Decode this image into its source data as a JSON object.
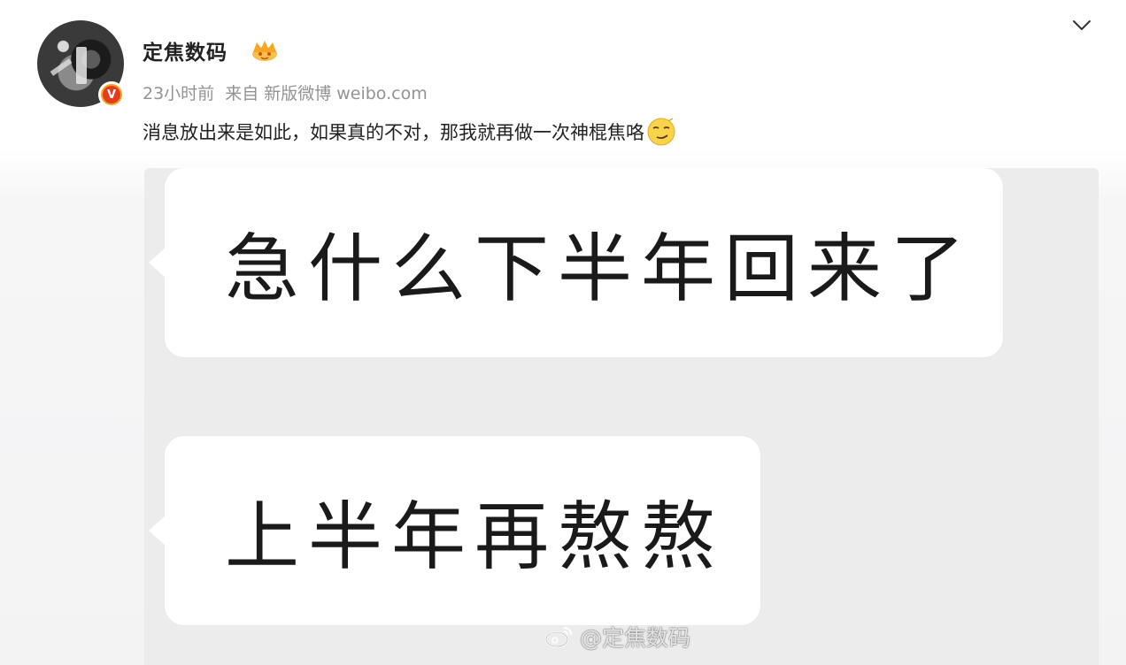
{
  "header": {
    "username": "定焦数码",
    "time": "23小时前",
    "source_prefix": "来自",
    "source": "新版微博 weibo.com"
  },
  "post": {
    "text": "消息放出来是如此，如果真的不对，那我就再做一次神棍焦咯"
  },
  "attachment": {
    "bubble_1": "急什么下半年回来了",
    "bubble_2": "上半年再熬熬",
    "watermark": "@定焦数码"
  },
  "icons": {
    "verified": "verified-v-icon",
    "member": "member-crown-icon",
    "menu": "chevron-down-icon",
    "emoji": "smirk-emoji-icon"
  },
  "colors": {
    "username": "#222222",
    "meta": "#939393",
    "verified_orange": "#f5a623",
    "verified_red": "#e53b1e",
    "attachment_bg": "#ececed"
  }
}
